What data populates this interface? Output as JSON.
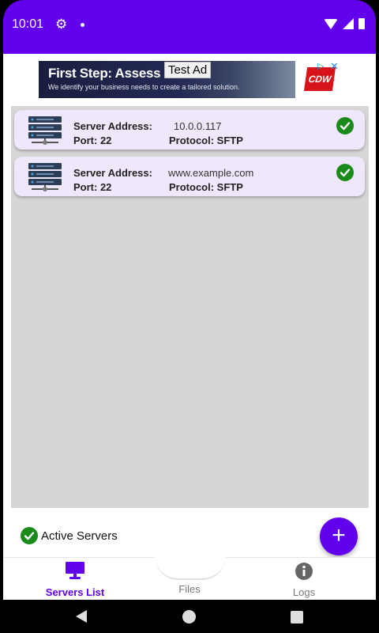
{
  "status_bar": {
    "time": "10:01",
    "gear_icon": "⚙",
    "background": "#6200ee"
  },
  "ad": {
    "headline": "First Step: Assess",
    "subtext": "We identify your business needs to create a tailored solution.",
    "badge": "Test Ad",
    "brand": "CDW",
    "choices_icon": "▷",
    "close_icon": "✕"
  },
  "servers": [
    {
      "address_label": "Server Address:",
      "address": "10.0.0.117",
      "port_label": "Port: 22",
      "protocol_label": "Protocol: SFTP",
      "status": "active"
    },
    {
      "address_label": "Server Address:",
      "address": "www.example.com",
      "port_label": "Port: 22",
      "protocol_label": "Protocol: SFTP",
      "status": "active"
    }
  ],
  "footer": {
    "active_label": "Active Servers",
    "fab_label": "+"
  },
  "bottom_nav": {
    "items": [
      {
        "label": "Servers List",
        "icon": "monitor-icon",
        "active": true
      },
      {
        "label": "Files",
        "icon": "none",
        "active": false
      },
      {
        "label": "Logs",
        "icon": "info-icon",
        "active": false
      }
    ]
  },
  "colors": {
    "accent": "#6200ee",
    "card": "#efe7fb",
    "check": "#1a8a1a",
    "list_background": "#d6d6d6"
  }
}
